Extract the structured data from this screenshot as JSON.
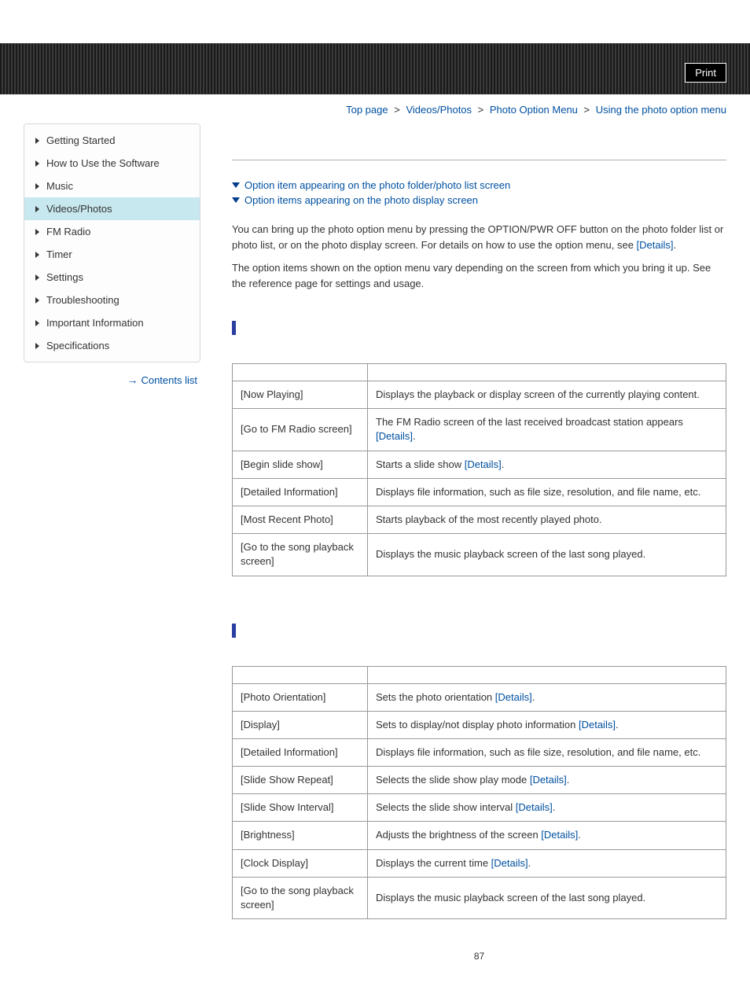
{
  "header": {
    "print": "Print"
  },
  "breadcrumb": {
    "items": [
      "Top page",
      "Videos/Photos",
      "Photo Option Menu",
      "Using the photo option menu"
    ],
    "sep": ">"
  },
  "sidebar": {
    "items": [
      "Getting Started",
      "How to Use the Software",
      "Music",
      "Videos/Photos",
      "FM Radio",
      "Timer",
      "Settings",
      "Troubleshooting",
      "Important Information",
      "Specifications"
    ],
    "active_index": 3,
    "contents_list": "Contents list"
  },
  "jumps": {
    "j1": "Option item appearing on the photo folder/photo list screen",
    "j2": "Option items appearing on the photo display screen"
  },
  "intro": {
    "p1a": "You can bring up the photo option menu by pressing the OPTION/PWR OFF button on the photo folder list or photo list, or on the photo display screen. For details on how to use the option menu, see ",
    "details": "[Details]",
    "dot": ".",
    "p2": "The option items shown on the option menu vary depending on the screen from which you bring it up. See the reference page for settings and usage."
  },
  "table1": {
    "rows": [
      {
        "item": "[Now Playing]",
        "desc": "Displays the playback or display screen of the currently playing content."
      },
      {
        "item": "[Go to FM Radio screen]",
        "desc_a": "The FM Radio screen of the last received broadcast station appears ",
        "details": "[Details]",
        "dot": "."
      },
      {
        "item": "[Begin slide show]",
        "desc_a": "Starts a slide show ",
        "details": "[Details]",
        "dot": "."
      },
      {
        "item": "[Detailed Information]",
        "desc": "Displays file information, such as file size, resolution, and file name, etc."
      },
      {
        "item": "[Most Recent Photo]",
        "desc": "Starts playback of the most recently played photo."
      },
      {
        "item": "[Go to the song playback screen]",
        "desc": "Displays the music playback screen of the last song played."
      }
    ]
  },
  "table2": {
    "rows": [
      {
        "item": "[Photo Orientation]",
        "desc_a": "Sets the photo orientation ",
        "details": "[Details]",
        "dot": "."
      },
      {
        "item": "[Display]",
        "desc_a": "Sets to display/not display photo information ",
        "details": "[Details]",
        "dot": "."
      },
      {
        "item": "[Detailed Information]",
        "desc": "Displays file information, such as file size, resolution, and file name, etc."
      },
      {
        "item": "[Slide Show Repeat]",
        "desc_a": "Selects the slide show play mode ",
        "details": "[Details]",
        "dot": "."
      },
      {
        "item": "[Slide Show Interval]",
        "desc_a": "Selects the slide show interval ",
        "details": "[Details]",
        "dot": "."
      },
      {
        "item": "[Brightness]",
        "desc_a": "Adjusts the brightness of the screen ",
        "details": "[Details]",
        "dot": "."
      },
      {
        "item": "[Clock Display]",
        "desc_a": "Displays the current time ",
        "details": "[Details]",
        "dot": "."
      },
      {
        "item": "[Go to the song playback screen]",
        "desc": "Displays the music playback screen of the last song played."
      }
    ]
  },
  "page_no": "87"
}
